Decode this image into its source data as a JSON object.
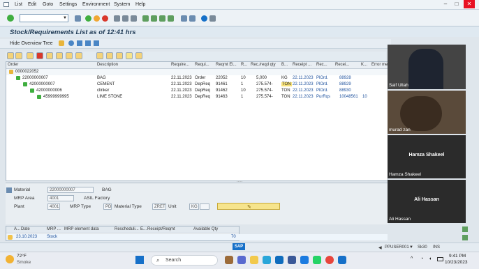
{
  "menu": [
    "List",
    "Edit",
    "Goto",
    "Settings",
    "Environment",
    "System",
    "Help"
  ],
  "title": "Stock/Requirements List as of 12:41 hrs",
  "app_toolbar": {
    "hide_tree": "Hide Overview Tree"
  },
  "table": {
    "headers": [
      "Order",
      "Description",
      "Require...",
      "Requi...",
      "Reqmt El...",
      "R...",
      "Rec./reqd qty",
      "B...",
      "Receipt ...",
      "Rec...",
      "Recei...",
      "K...",
      "Error me..."
    ],
    "rows": [
      {
        "node": "0000022052",
        "level": 0,
        "desc": "",
        "date": "",
        "type": "",
        "element": "",
        "r": "",
        "qty": "",
        "unit": "",
        "rdate": "",
        "rec": "",
        "recei": "",
        "k": ""
      },
      {
        "node": "22000000007",
        "level": 1,
        "desc": "BAG",
        "date": "22.11.2023",
        "type": "Order",
        "element": "22052",
        "r": "10",
        "qty": "5,000",
        "unit": "KG",
        "rdate": "22.11.2023",
        "rec": "PlOrd.",
        "recei": "88928",
        "k": ""
      },
      {
        "node": "42000000007",
        "level": 2,
        "desc": "CEMENT",
        "date": "22.11.2023",
        "type": "DepReq",
        "element": "91461",
        "r": "1",
        "qty": "275.574-",
        "unit": "TON",
        "rdate": "22.11.2023",
        "rec": "PlOrd.",
        "recei": "88929",
        "k": ""
      },
      {
        "node": "42000000006",
        "level": 3,
        "desc": "clinker",
        "date": "22.11.2023",
        "type": "DepReq",
        "element": "91462",
        "r": "10",
        "qty": "275.574-",
        "unit": "TON",
        "rdate": "22.11.2023",
        "rec": "PlOrd.",
        "recei": "88930",
        "k": ""
      },
      {
        "node": "45999999995",
        "level": 4,
        "desc": "LIME STONE",
        "date": "22.11.2023",
        "type": "DepReq",
        "element": "91463",
        "r": "1",
        "qty": "275.574-",
        "unit": "TON",
        "rdate": "22.11.2023",
        "rec": "PurRqs",
        "recei": "10048561",
        "k": "10"
      }
    ]
  },
  "detail": {
    "material_label": "Material",
    "material_value": "22000000007",
    "material_desc": "BAG",
    "mrp_area_label": "MRP Area",
    "mrp_area_value": "4001",
    "mrp_area_desc": "ASIL Factory",
    "plant_label": "Plant",
    "plant_value": "4001",
    "mrp_type_label": "MRP Type",
    "mrp_type_value": "PD",
    "material_type_label": "Material Type",
    "material_type_value": "ZRET",
    "unit_label": "Unit",
    "unit_value": "KG"
  },
  "bottom_table": {
    "headers": [
      "A...",
      "Date",
      "MRP ...",
      "MRP element data",
      "Rescheduli...",
      "E...",
      "Receipt/Reqmt",
      "Available Qty"
    ],
    "row": {
      "date": "23.10.2023",
      "mrp": "Stock",
      "available": "70"
    }
  },
  "status": {
    "user": "PPUSER001",
    "server": "Sk30",
    "mode": "INS"
  },
  "participants": [
    {
      "name": "Saif Ullah",
      "center": ""
    },
    {
      "name": "murad zan",
      "center": ""
    },
    {
      "name": "Hamza Shakeel",
      "center": "Hamza Shakeel"
    },
    {
      "name": "Ali Hassan",
      "center": "Ali Hassan"
    }
  ],
  "taskbar": {
    "weather_temp": "72°F",
    "weather_desc": "Smoke",
    "search": "Search",
    "time": "9:41 PM",
    "date": "10/23/2023"
  },
  "colors": {
    "accent": "#1b4f9c",
    "sap_blue": "#1670c8",
    "tree_node": "#3fae3f",
    "highlight": "#f6e48c"
  }
}
